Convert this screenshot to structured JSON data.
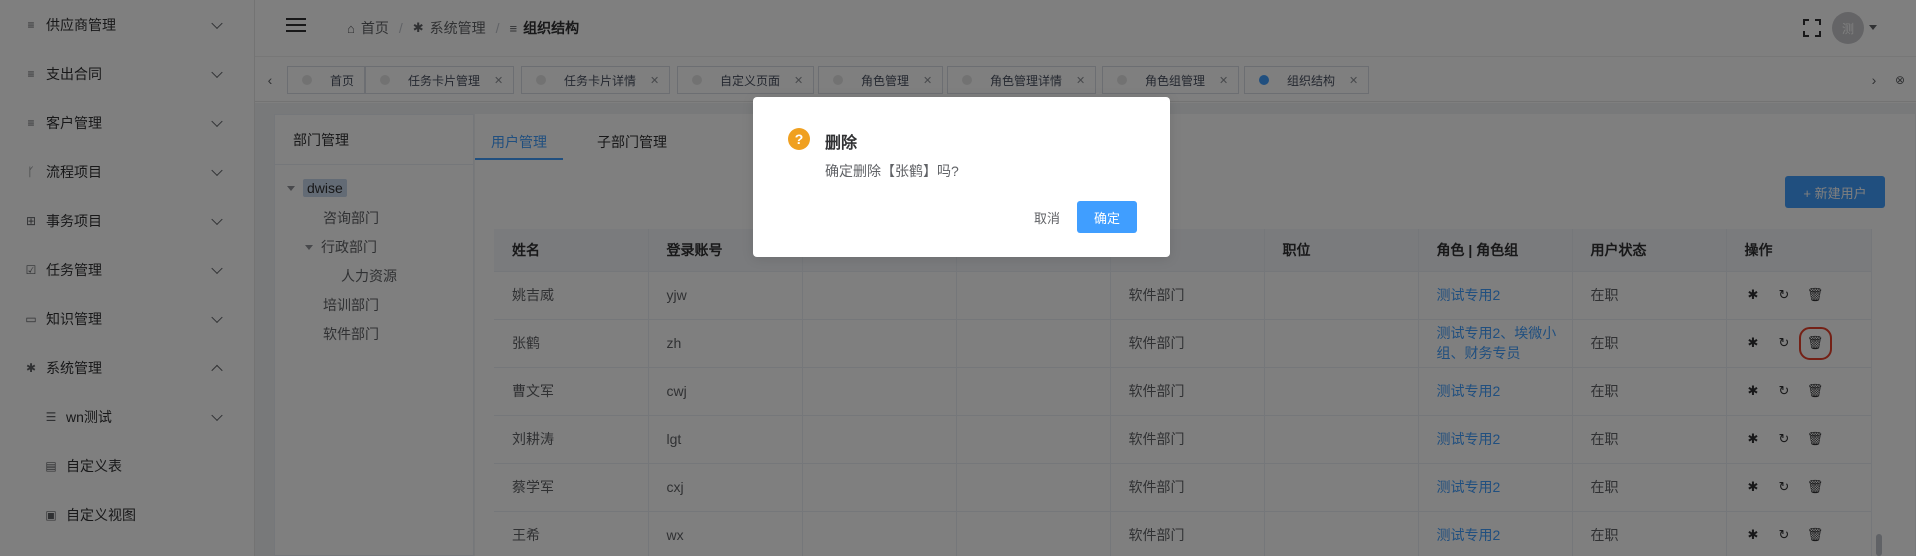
{
  "sidebar": {
    "items": [
      {
        "label": "供应商管理",
        "icon": "list-icon",
        "expanded": false
      },
      {
        "label": "支出合同",
        "icon": "list-icon",
        "expanded": false
      },
      {
        "label": "客户管理",
        "icon": "list-icon",
        "expanded": false
      },
      {
        "label": "流程项目",
        "icon": "branch-icon",
        "expanded": false
      },
      {
        "label": "事务项目",
        "icon": "grid-icon",
        "expanded": false
      },
      {
        "label": "任务管理",
        "icon": "checkbox-icon",
        "expanded": false
      },
      {
        "label": "知识管理",
        "icon": "book-icon",
        "expanded": false
      },
      {
        "label": "系统管理",
        "icon": "gear-icon",
        "expanded": true
      }
    ],
    "subitems": [
      {
        "label": "wn测试",
        "icon": "filter-icon"
      },
      {
        "label": "自定义表",
        "icon": "doc-icon"
      },
      {
        "label": "自定义视图",
        "icon": "copy-icon"
      }
    ]
  },
  "header": {
    "breadcrumb": [
      "首页",
      "系统管理",
      "组织结构"
    ],
    "avatar_text": "测"
  },
  "tabs": [
    {
      "label": "首页",
      "closable": false,
      "active": false
    },
    {
      "label": "任务卡片管理",
      "closable": true,
      "active": false
    },
    {
      "label": "任务卡片详情",
      "closable": true,
      "active": false
    },
    {
      "label": "自定义页面",
      "closable": true,
      "active": false
    },
    {
      "label": "角色管理",
      "closable": true,
      "active": false
    },
    {
      "label": "角色管理详情",
      "closable": true,
      "active": false
    },
    {
      "label": "角色组管理",
      "closable": true,
      "active": false
    },
    {
      "label": "组织结构",
      "closable": true,
      "active": true
    }
  ],
  "dept": {
    "title": "部门管理",
    "tree": [
      "dwise",
      "咨询部门",
      "行政部门",
      "人力资源",
      "培训部门",
      "软件部门"
    ]
  },
  "user_tabs": [
    "用户管理",
    "子部门管理"
  ],
  "new_user_label": "+ 新建用户",
  "table": {
    "headers": [
      "姓名",
      "登录账号",
      "",
      "",
      "",
      "职位",
      "角色 | 角色组",
      "用户状态",
      "操作"
    ],
    "rows": [
      {
        "name": "姚吉威",
        "account": "yjw",
        "dept": "软件部门",
        "role": "测试专用2",
        "status": "在职"
      },
      {
        "name": "张鹤",
        "account": "zh",
        "dept": "软件部门",
        "role": "测试专用2、埃微小组、财务专员",
        "status": "在职"
      },
      {
        "name": "曹文军",
        "account": "cwj",
        "dept": "软件部门",
        "role": "测试专用2",
        "status": "在职"
      },
      {
        "name": "刘耕涛",
        "account": "lgt",
        "dept": "软件部门",
        "role": "测试专用2",
        "status": "在职"
      },
      {
        "name": "蔡学军",
        "account": "cxj",
        "dept": "软件部门",
        "role": "测试专用2",
        "status": "在职"
      },
      {
        "name": "王希",
        "account": "wx",
        "dept": "软件部门",
        "role": "测试专用2",
        "status": "在职"
      }
    ]
  },
  "dialog": {
    "icon": "question-icon",
    "title": "删除",
    "message": "确定删除【张鹤】吗?",
    "cancel_label": "取消",
    "ok_label": "确定"
  },
  "colors": {
    "primary": "#409eff",
    "warning": "#f0a020",
    "highlight": "#e8412b"
  }
}
